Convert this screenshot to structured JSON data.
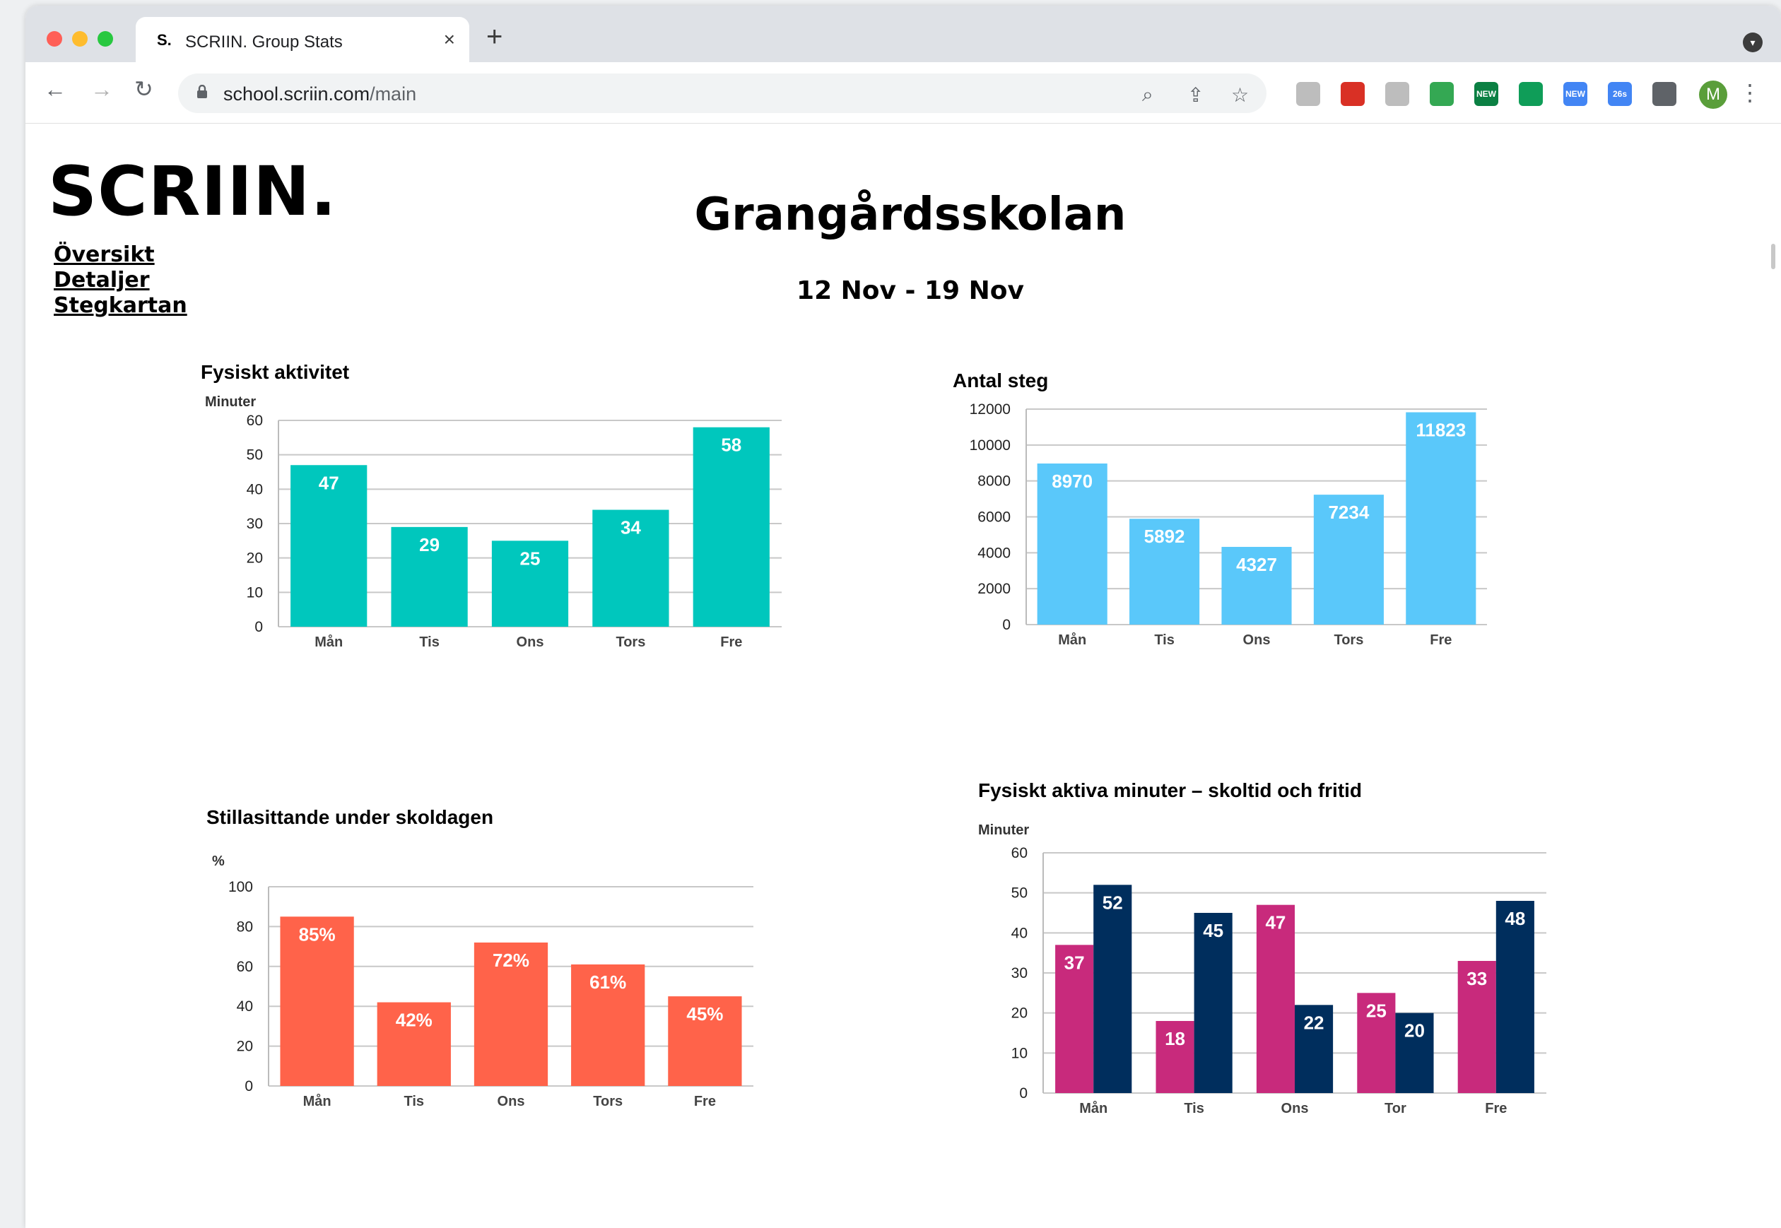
{
  "browser": {
    "tab_favicon": "S.",
    "tab_title": "SCRIIN. Group Stats",
    "tab_close": "×",
    "new_tab": "+",
    "url_host": "school.scriin.com",
    "url_path": "/main",
    "profile_initial": "M",
    "extensions": [
      {
        "name": "cast-icon",
        "color": "#bdbdbd",
        "label": ""
      },
      {
        "name": "pdf-icon",
        "color": "#d93025",
        "label": ""
      },
      {
        "name": "leaf-icon",
        "color": "#bdbdbd",
        "label": ""
      },
      {
        "name": "drive-icon",
        "color": "#34a853",
        "label": ""
      },
      {
        "name": "gauge-new-icon",
        "color": "#0b8043",
        "label": "NEW"
      },
      {
        "name": "chat-bubble-icon",
        "color": "#0f9d58",
        "label": ""
      },
      {
        "name": "gauge-new-icon-2",
        "color": "#4285f4",
        "label": "NEW"
      },
      {
        "name": "timer-icon",
        "color": "#4285f4",
        "label": "26s"
      },
      {
        "name": "puzzle-icon",
        "color": "#5f6368",
        "label": ""
      }
    ]
  },
  "page": {
    "logo": "SCRIIN.",
    "nav": [
      "Översikt",
      "Detaljer",
      "Stegkartan"
    ],
    "school_name": "Grangårdsskolan",
    "date_range": "12 Nov - 19 Nov"
  },
  "chart_data": [
    {
      "type": "bar",
      "title": "Fysiskt aktivitet",
      "ylabel": "Minuter",
      "categories": [
        "Mån",
        "Tis",
        "Ons",
        "Tors",
        "Fre"
      ],
      "values": [
        47,
        29,
        25,
        34,
        58
      ],
      "labels": [
        "47",
        "29",
        "25",
        "34",
        "58"
      ],
      "yticks": [
        0,
        10,
        20,
        30,
        40,
        50,
        60
      ],
      "ylim": [
        0,
        60
      ],
      "color": "#00c7bd",
      "grid": true
    },
    {
      "type": "bar",
      "title": "Antal steg",
      "ylabel": "",
      "categories": [
        "Mån",
        "Tis",
        "Ons",
        "Tors",
        "Fre"
      ],
      "values": [
        8970,
        5892,
        4327,
        7234,
        11823
      ],
      "labels": [
        "8970",
        "5892",
        "4327",
        "7234",
        "11823"
      ],
      "yticks": [
        0,
        2000,
        4000,
        6000,
        8000,
        10000,
        12000
      ],
      "ylim": [
        0,
        12000
      ],
      "color": "#5ac8fa",
      "grid": true
    },
    {
      "type": "bar",
      "title": "Stillasittande under skoldagen",
      "ylabel": "%",
      "categories": [
        "Mån",
        "Tis",
        "Ons",
        "Tors",
        "Fre"
      ],
      "values": [
        85,
        42,
        72,
        61,
        45
      ],
      "labels": [
        "85%",
        "42%",
        "72%",
        "61%",
        "45%"
      ],
      "yticks": [
        0,
        20,
        40,
        60,
        80,
        100
      ],
      "ylim": [
        0,
        100
      ],
      "color": "#ff634a",
      "grid": true
    },
    {
      "type": "bar",
      "title": "Fysiskt aktiva minuter – skoltid och fritid",
      "ylabel": "Minuter",
      "categories": [
        "Mån",
        "Tis",
        "Ons",
        "Tor",
        "Fre"
      ],
      "series": [
        {
          "values": [
            37,
            18,
            47,
            25,
            33
          ],
          "color": "#c82a7c"
        },
        {
          "values": [
            52,
            45,
            22,
            20,
            48
          ],
          "color": "#002e5d"
        }
      ],
      "yticks": [
        0,
        10,
        20,
        30,
        40,
        50,
        60
      ],
      "ylim": [
        0,
        60
      ],
      "grid": true
    }
  ]
}
